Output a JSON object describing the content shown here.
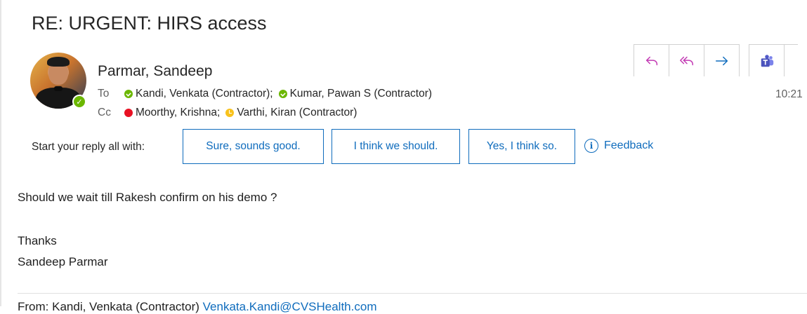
{
  "email": {
    "subject": "RE: URGENT: HIRS access",
    "sender": "Parmar, Sandeep",
    "time": "10:21",
    "to_label": "To",
    "to": [
      {
        "name": "Kandi, Venkata (Contractor);",
        "status": "available"
      },
      {
        "name": "Kumar, Pawan S (Contractor)",
        "status": "available"
      }
    ],
    "cc_label": "Cc",
    "cc": [
      {
        "name": "Moorthy, Krishna;",
        "status": "busy"
      },
      {
        "name": "Varthi, Kiran (Contractor)",
        "status": "away"
      }
    ],
    "body": {
      "line1": "Should we wait till Rakesh confirm on his demo ?",
      "line2": "Thanks",
      "line3": "Sandeep Parmar"
    },
    "quoted_from_label": "From:",
    "quoted_from_name": "Kandi, Venkata (Contractor)",
    "quoted_from_email": "Venkata.Kandi@CVSHealth.com"
  },
  "toolbar": {
    "icons": [
      "reply-icon",
      "reply-all-icon",
      "forward-icon",
      "teams-icon"
    ]
  },
  "suggestions": {
    "label": "Start your reply all with:",
    "chips": [
      "Sure, sounds good.",
      "I think we should.",
      "Yes, I think so."
    ],
    "feedback": "Feedback"
  },
  "colors": {
    "accent": "#0f6cbd",
    "reply_icons": "#c239b3",
    "available": "#6bb700",
    "busy": "#e81123",
    "away": "#f8c21d"
  }
}
